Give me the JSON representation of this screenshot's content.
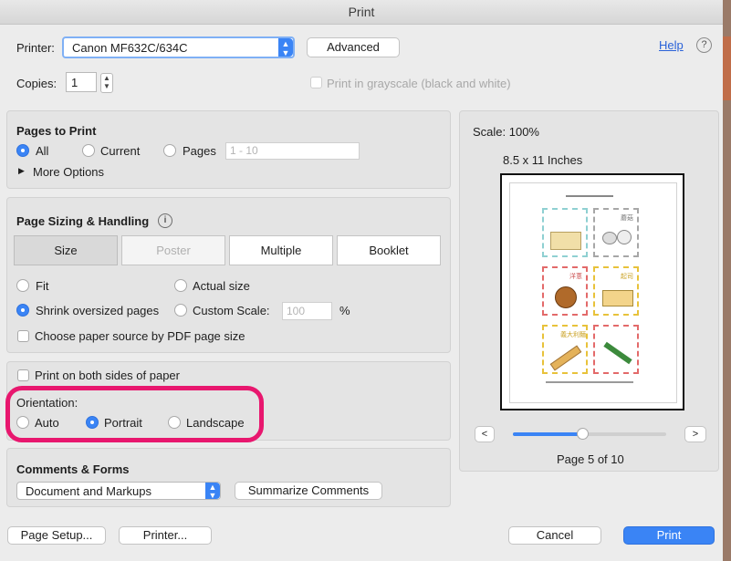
{
  "window": {
    "title": "Print"
  },
  "printer": {
    "label": "Printer:",
    "value": "Canon MF632C/634C",
    "advanced": "Advanced",
    "help": "Help"
  },
  "copies": {
    "label": "Copies:",
    "value": "1"
  },
  "grayscale": {
    "label": "Print in grayscale (black and white)"
  },
  "pages": {
    "heading": "Pages to Print",
    "all": "All",
    "current": "Current",
    "pages": "Pages",
    "range_placeholder": "1 - 10",
    "more_options": "More Options"
  },
  "sizing": {
    "heading": "Page Sizing & Handling",
    "tabs": [
      "Size",
      "Poster",
      "Multiple",
      "Booklet"
    ],
    "fit": "Fit",
    "actual": "Actual size",
    "shrink": "Shrink oversized pages",
    "custom": "Custom Scale:",
    "scale_placeholder": "100",
    "percent": "%",
    "paper_source": "Choose paper source by PDF page size"
  },
  "duplex": {
    "label": "Print on both sides of paper"
  },
  "orientation": {
    "heading": "Orientation:",
    "auto": "Auto",
    "portrait": "Portrait",
    "landscape": "Landscape"
  },
  "comments": {
    "heading": "Comments & Forms",
    "value": "Document and Markups",
    "summarize": "Summarize Comments"
  },
  "preview": {
    "scale": "Scale: 100%",
    "paper": "8.5 x 11 Inches",
    "prev": "<",
    "next": ">",
    "page_indicator": "Page 5 of 10",
    "slider_fraction": 0.45,
    "tile_labels": [
      "蘑菇",
      "洋蔥",
      "起司",
      "義大利麵"
    ]
  },
  "footer": {
    "page_setup": "Page Setup...",
    "printer": "Printer...",
    "cancel": "Cancel",
    "print": "Print"
  },
  "colors": {
    "accent": "#3a84f5",
    "highlight": "#e8176e"
  }
}
